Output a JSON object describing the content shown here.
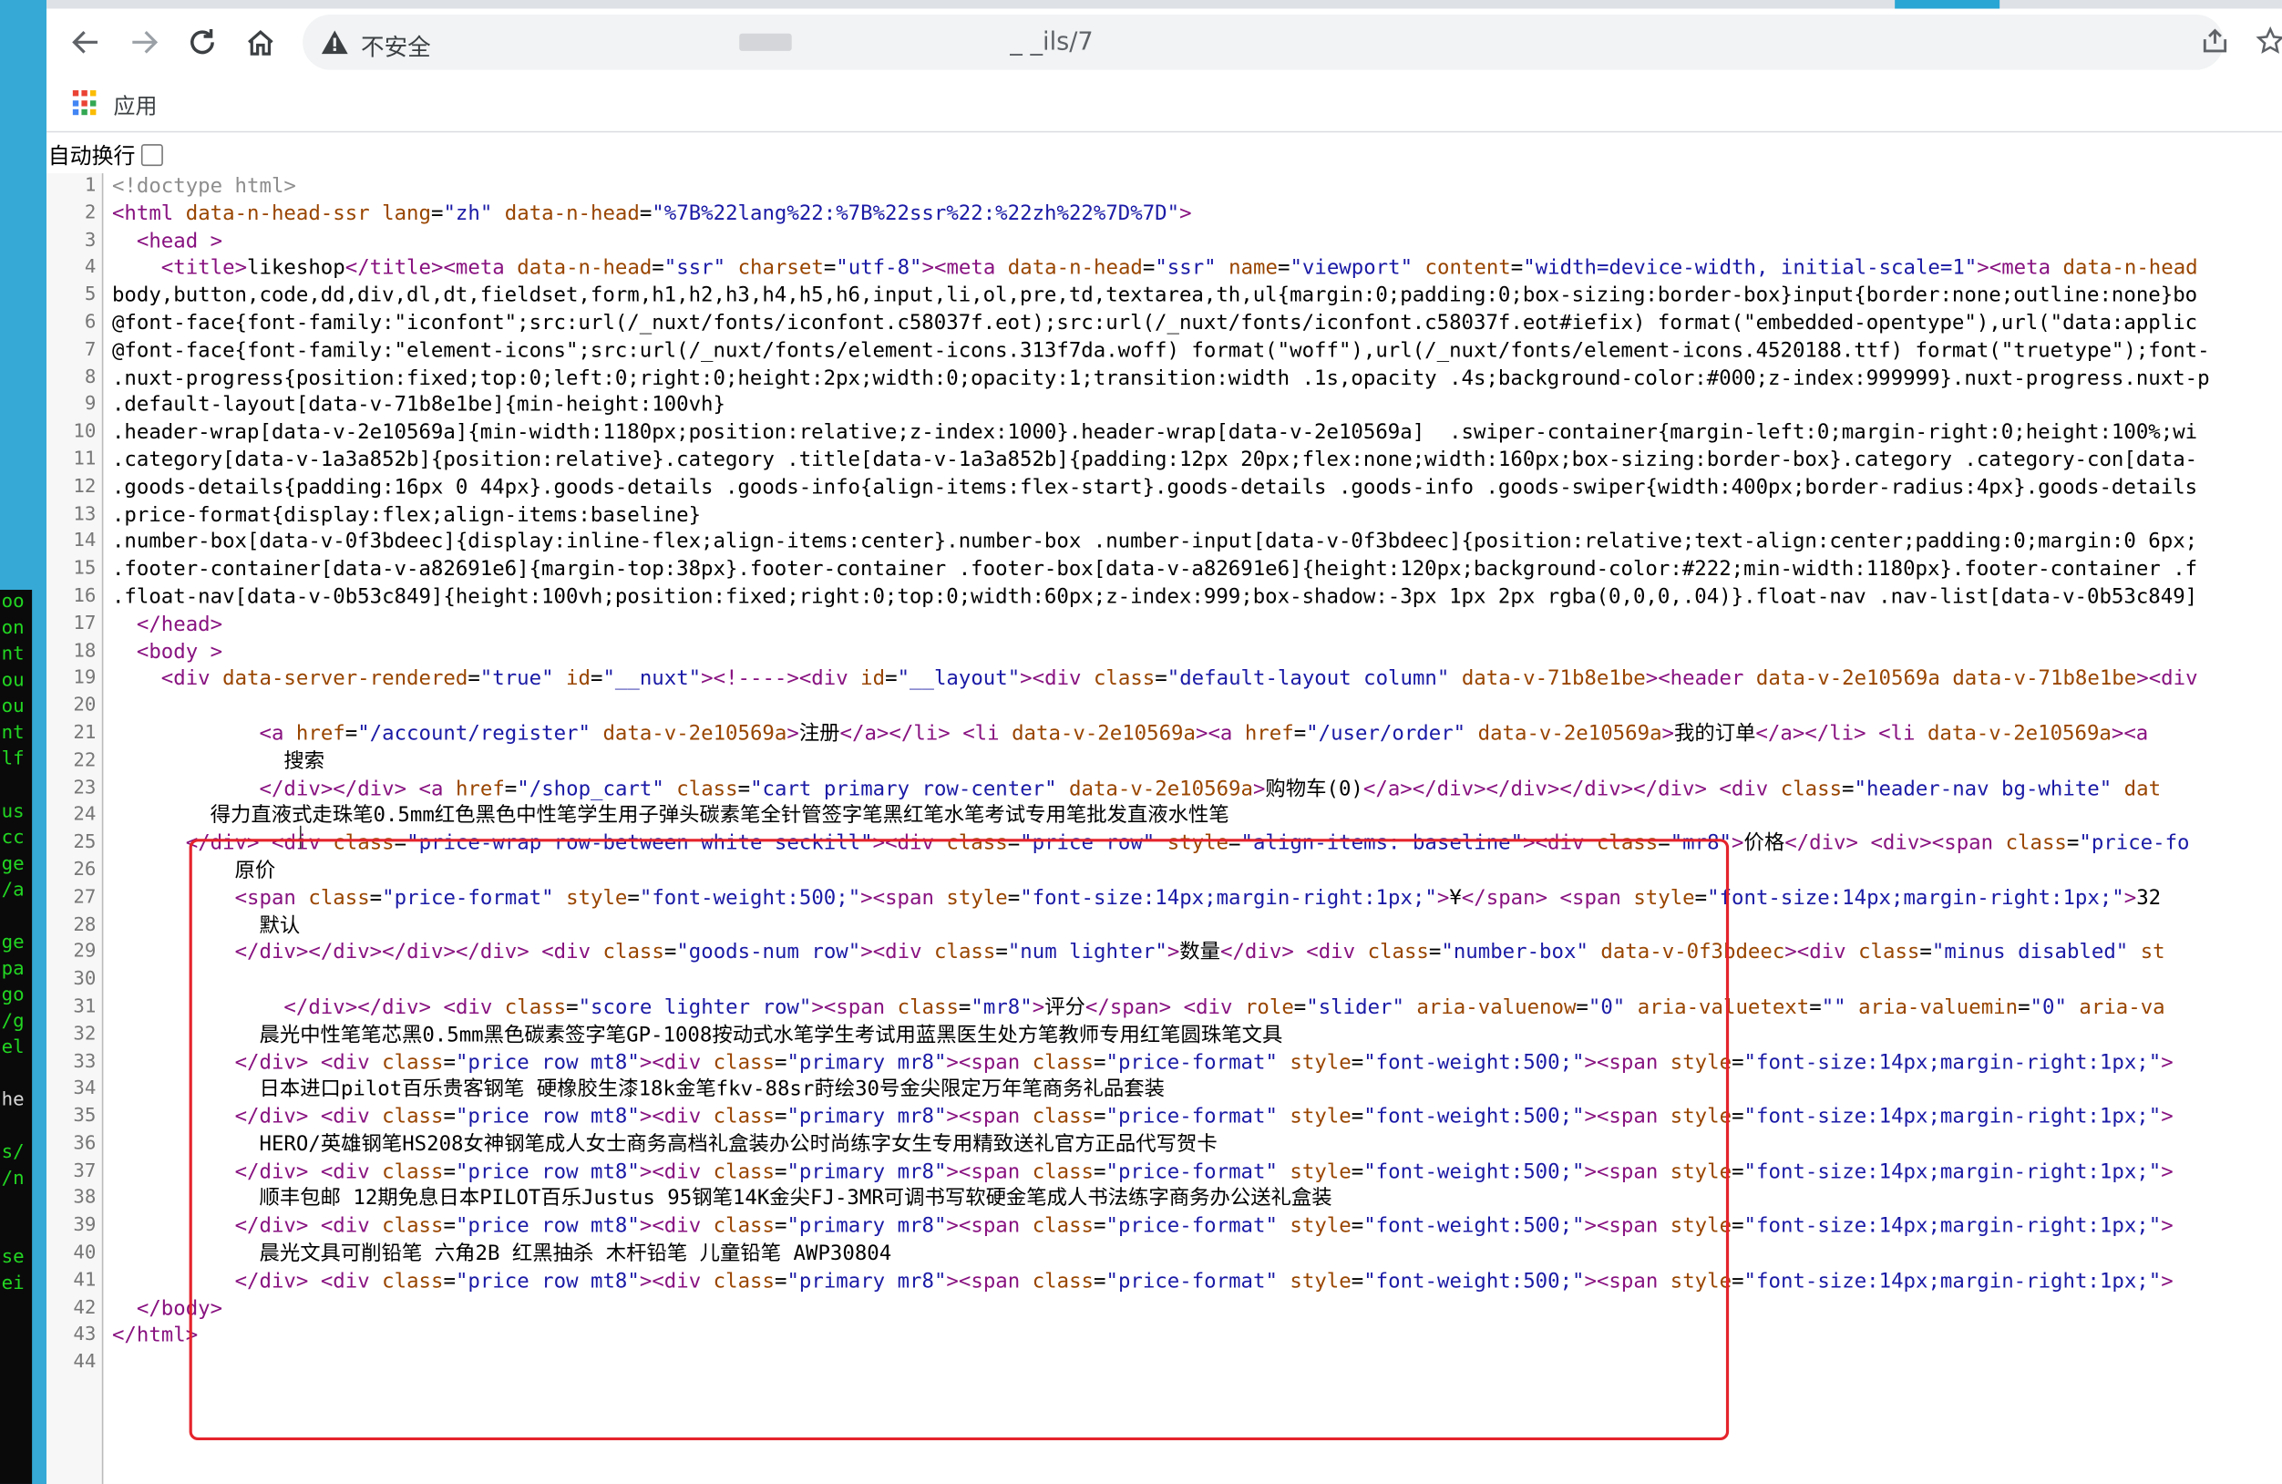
{
  "window": {
    "insecure_label": "不安全",
    "url_path": "_ _ils/7",
    "bookmarks_apps_label": "应用"
  },
  "source_view": {
    "wrap_label": "自动换行",
    "line_numbers": [
      "1",
      "2",
      "3",
      "4",
      "5",
      "6",
      "7",
      "8",
      "9",
      "10",
      "11",
      "12",
      "13",
      "14",
      "15",
      "16",
      "17",
      "18",
      "19",
      "20",
      "21",
      "22",
      "23",
      "24",
      "25",
      "26",
      "27",
      "28",
      "29",
      "30",
      "31",
      "32",
      "33",
      "34",
      "35",
      "36",
      "37",
      "38",
      "39",
      "40",
      "41",
      "42",
      "43",
      "44"
    ],
    "lines": [
      "<!doctype html>",
      "<html data-n-head-ssr lang=\"zh\" data-n-head=\"%7B%22lang%22:%7B%22ssr%22:%22zh%22%7D%7D\">",
      "  <head >",
      "    <title>likeshop</title><meta data-n-head=\"ssr\" charset=\"utf-8\"><meta data-n-head=\"ssr\" name=\"viewport\" content=\"width=device-width, initial-scale=1\"><meta data-n-head",
      "body,button,code,dd,div,dl,dt,fieldset,form,h1,h2,h3,h4,h5,h6,input,li,ol,pre,td,textarea,th,ul{margin:0;padding:0;box-sizing:border-box}input{border:none;outline:none}bo",
      "@font-face{font-family:\"iconfont\";src:url(/_nuxt/fonts/iconfont.c58037f.eot);src:url(/_nuxt/fonts/iconfont.c58037f.eot#iefix) format(\"embedded-opentype\"),url(\"data:applic",
      "@font-face{font-family:\"element-icons\";src:url(/_nuxt/fonts/element-icons.313f7da.woff) format(\"woff\"),url(/_nuxt/fonts/element-icons.4520188.ttf) format(\"truetype\");font-",
      ".nuxt-progress{position:fixed;top:0;left:0;right:0;height:2px;width:0;opacity:1;transition:width .1s,opacity .4s;background-color:#000;z-index:999999}.nuxt-progress.nuxt-p",
      ".default-layout[data-v-71b8e1be]{min-height:100vh}",
      ".header-wrap[data-v-2e10569a]{min-width:1180px;position:relative;z-index:1000}.header-wrap[data-v-2e10569a]  .swiper-container{margin-left:0;margin-right:0;height:100%;wi",
      ".category[data-v-1a3a852b]{position:relative}.category .title[data-v-1a3a852b]{padding:12px 20px;flex:none;width:160px;box-sizing:border-box}.category .category-con[data-",
      ".goods-details{padding:16px 0 44px}.goods-details .goods-info{align-items:flex-start}.goods-details .goods-info .goods-swiper{width:400px;border-radius:4px}.goods-details",
      ".price-format{display:flex;align-items:baseline}",
      ".number-box[data-v-0f3bdeec]{display:inline-flex;align-items:center}.number-box .number-input[data-v-0f3bdeec]{position:relative;text-align:center;padding:0;margin:0 6px;",
      ".footer-container[data-v-a82691e6]{margin-top:38px}.footer-container .footer-box[data-v-a82691e6]{height:120px;background-color:#222;min-width:1180px}.footer-container .f",
      ".float-nav[data-v-0b53c849]{height:100vh;position:fixed;right:0;top:0;width:60px;z-index:999;box-shadow:-3px 1px 2px rgba(0,0,0,.04)}.float-nav .nav-list[data-v-0b53c849]",
      "  </head>",
      "  <body >",
      "    <div data-server-rendered=\"true\" id=\"__nuxt\"><!----><div id=\"__layout\"><div class=\"default-layout column\" data-v-71b8e1be><header data-v-2e10569a data-v-71b8e1be><div",
      "",
      "            <a href=\"/account/register\" data-v-2e10569a>注册</a></li> <li data-v-2e10569a><a href=\"/user/order\" data-v-2e10569a>我的订单</a></li> <li data-v-2e10569a><a",
      "              搜索",
      "            </div></div> <a href=\"/shop_cart\" class=\"cart primary row-center\" data-v-2e10569a>购物车(0)</a></div></div></div></div> <div class=\"header-nav bg-white\" dat",
      "        得力直液式走珠笔0.5mm红色黑色中性笔学生用子弹头碳素笔全针管签字笔黑红笔水笔考试专用笔批发直液水性笔",
      "      </div> <div class=\"price-wrap row-between white seckill\"><div class=\"price row\" style=\"align-items: baseline\"><div class=\"mr8\">价格</div> <div><span class=\"price-fo",
      "          原价",
      "          <span class=\"price-format\" style=\"font-weight:500;\"><span style=\"font-size:14px;margin-right:1px;\">¥</span> <span style=\"font-size:14px;margin-right:1px;\">32",
      "            默认",
      "          </div></div></div></div> <div class=\"goods-num row\"><div class=\"num lighter\">数量</div> <div class=\"number-box\" data-v-0f3bdeec><div class=\"minus disabled\" st",
      "",
      "              </div></div> <div class=\"score lighter row\"><span class=\"mr8\">评分</span> <div role=\"slider\" aria-valuenow=\"0\" aria-valuetext=\"\" aria-valuemin=\"0\" aria-va",
      "            晨光中性笔笔芯黑0.5mm黑色碳素签字笔GP-1008按动式水笔学生考试用蓝黑医生处方笔教师专用红笔圆珠笔文具",
      "          </div> <div class=\"price row mt8\"><div class=\"primary mr8\"><span class=\"price-format\" style=\"font-weight:500;\"><span style=\"font-size:14px;margin-right:1px;\">",
      "            日本进口pilot百乐贵客钢笔 硬橡胶生漆18k金笔fkv-88sr莳绘30号金尖限定万年笔商务礼品套装",
      "          </div> <div class=\"price row mt8\"><div class=\"primary mr8\"><span class=\"price-format\" style=\"font-weight:500;\"><span style=\"font-size:14px;margin-right:1px;\">",
      "            HERO/英雄钢笔HS208女神钢笔成人女士商务高档礼盒装办公时尚练字女生专用精致送礼官方正品代写贺卡",
      "          </div> <div class=\"price row mt8\"><div class=\"primary mr8\"><span class=\"price-format\" style=\"font-weight:500;\"><span style=\"font-size:14px;margin-right:1px;\">",
      "            顺丰包邮 12期免息日本PILOT百乐Justus 95钢笔14K金尖FJ-3MR可调书写软硬金笔成人书法练字商务办公送礼盒装",
      "          </div> <div class=\"price row mt8\"><div class=\"primary mr8\"><span class=\"price-format\" style=\"font-weight:500;\"><span style=\"font-size:14px;margin-right:1px;\">",
      "            晨光文具可削铅笔 六角2B 红黑抽杀 木杆铅笔 儿童铅笔 AWP30804",
      "          </div> <div class=\"price row mt8\"><div class=\"primary mr8\"><span class=\"price-format\" style=\"font-weight:500;\"><span style=\"font-size:14px;margin-right:1px;\">",
      "  </body>",
      "</html>",
      ""
    ]
  },
  "terminal": {
    "lines": [
      "oo",
      "on",
      "nt",
      "ou",
      "ou",
      "nt",
      "lf",
      "",
      "us",
      "cc",
      "ge",
      "/a",
      "",
      "ge",
      "pa",
      "go",
      "/g",
      "el",
      "",
      "he",
      "",
      "s/",
      "/n",
      "",
      "",
      "se",
      "ei"
    ]
  },
  "colors": {
    "desktop_bg": "#2aa6d4",
    "terminal_text": "#22d622",
    "highlight_box": "#e5242c"
  },
  "icons": {
    "back": "arrow-left-icon",
    "forward": "arrow-right-icon",
    "reload": "reload-icon",
    "home": "home-icon",
    "insecure": "warning-triangle-icon",
    "share": "share-icon",
    "bookmark": "star-icon",
    "apps": "apps-grid-icon"
  }
}
